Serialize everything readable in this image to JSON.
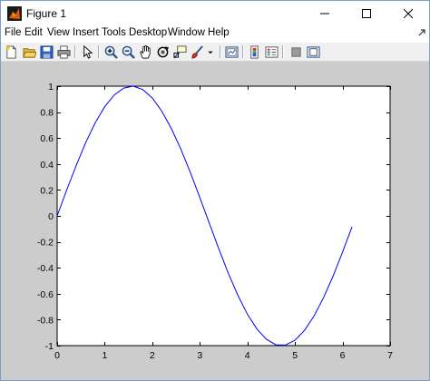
{
  "window": {
    "title": "Figure 1",
    "controls": [
      "minimize",
      "maximize",
      "close"
    ]
  },
  "menu": {
    "items": [
      "File",
      "Edit",
      "View",
      "Insert",
      "Tools",
      "Desktop",
      "Window",
      "Help"
    ]
  },
  "toolbar": {
    "buttons": [
      "new-figure-icon",
      "open-file-icon",
      "save-icon",
      "print-icon",
      "edit-plot-arrow-icon",
      "zoom-in-icon",
      "zoom-out-icon",
      "pan-hand-icon",
      "rotate-3d-icon",
      "data-cursor-icon",
      "brush-icon",
      "link-plot-icon",
      "insert-colorbar-icon",
      "insert-legend-icon",
      "hide-plot-tools-icon",
      "show-plot-tools-icon"
    ]
  },
  "colors": {
    "line": "#0000ff",
    "figure_background": "#cccccc",
    "axes_background": "#ffffff"
  },
  "chart_data": {
    "type": "line",
    "title": "",
    "xlabel": "",
    "ylabel": "",
    "xlim": [
      0,
      7
    ],
    "ylim": [
      -1,
      1
    ],
    "xticks": [
      0,
      1,
      2,
      3,
      4,
      5,
      6,
      7
    ],
    "xtick_labels": [
      "0",
      "1",
      "2",
      "3",
      "4",
      "5",
      "6",
      "7"
    ],
    "yticks": [
      -1,
      -0.8,
      -0.6,
      -0.4,
      -0.2,
      0,
      0.2,
      0.4,
      0.6,
      0.8,
      1
    ],
    "ytick_labels": [
      "-1",
      "-0.8",
      "-0.6",
      "-0.4",
      "-0.2",
      "0",
      "0.2",
      "0.4",
      "0.6",
      "0.8",
      "1"
    ],
    "grid": false,
    "series": [
      {
        "color": "#0000ff",
        "x": [
          0,
          0.2,
          0.4,
          0.6,
          0.8,
          1.0,
          1.2,
          1.4,
          1.6,
          1.8,
          2.0,
          2.2,
          2.4,
          2.6,
          2.8,
          3.0,
          3.2,
          3.4,
          3.6,
          3.8,
          4.0,
          4.2,
          4.4,
          4.6,
          4.8,
          5.0,
          5.2,
          5.4,
          5.6,
          5.8,
          6.0,
          6.2
        ],
        "y": [
          0,
          0.199,
          0.389,
          0.565,
          0.717,
          0.841,
          0.932,
          0.985,
          1.0,
          0.974,
          0.909,
          0.808,
          0.675,
          0.516,
          0.335,
          0.141,
          -0.058,
          -0.256,
          -0.443,
          -0.612,
          -0.757,
          -0.872,
          -0.952,
          -0.994,
          -0.996,
          -0.959,
          -0.883,
          -0.773,
          -0.631,
          -0.465,
          -0.279,
          -0.083
        ]
      }
    ]
  }
}
